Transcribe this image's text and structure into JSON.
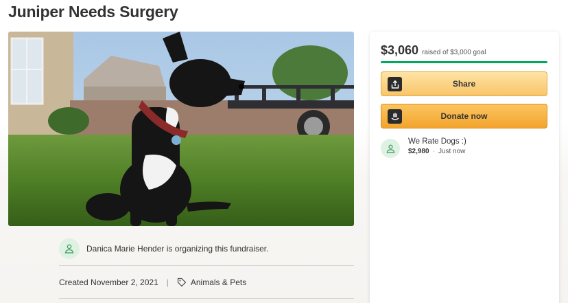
{
  "page": {
    "title": "Juniper Needs Surgery"
  },
  "organizer": {
    "text": "Danica Marie Hender is organizing this fundraiser."
  },
  "meta": {
    "created": "Created November 2, 2021",
    "category": "Animals & Pets"
  },
  "sidebar": {
    "amount": "$3,060",
    "goal_text": "raised of $3,000 goal",
    "progress_percent": 100,
    "share_label": "Share",
    "donate_label": "Donate now"
  },
  "donations": [
    {
      "name": "We Rate Dogs :)",
      "amount": "$2,980",
      "time": "Just now"
    }
  ],
  "colors": {
    "progress": "#02a95c",
    "share_button": "#f9c56a",
    "donate_button": "#f2a42d",
    "avatar_bg": "#dff1e3"
  },
  "icons": {
    "share": "share-upload-icon",
    "donate": "donate-icon",
    "tag": "tag-icon",
    "avatar": "user-heart-icon"
  }
}
